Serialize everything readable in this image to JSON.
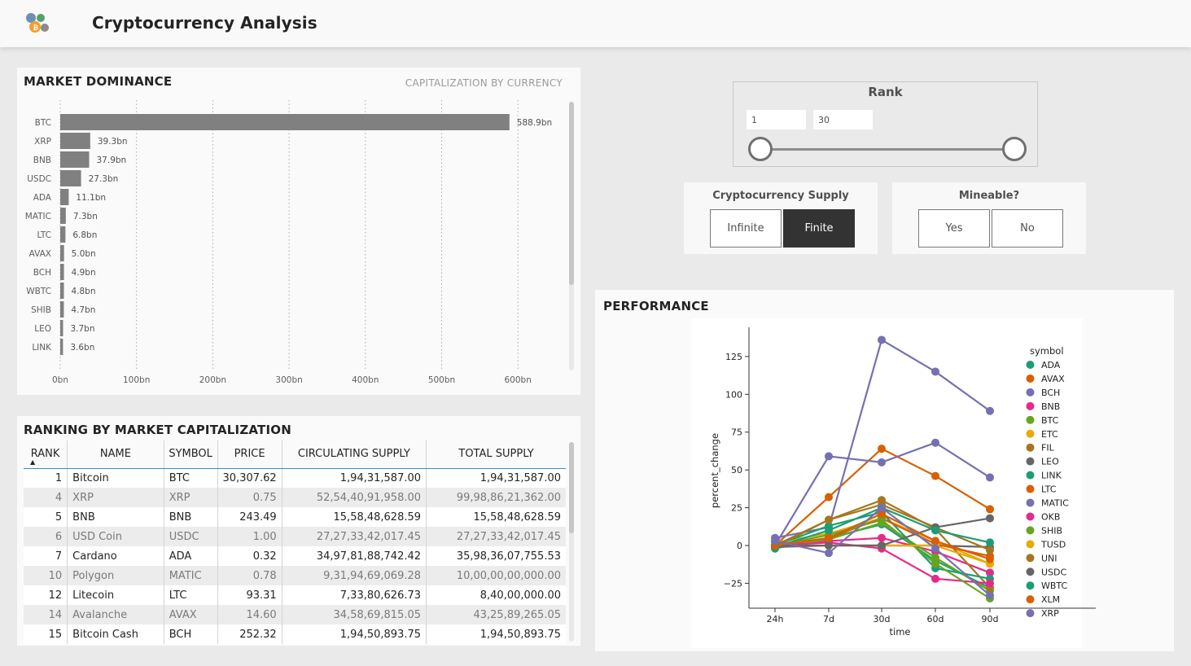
{
  "header": {
    "title": "Cryptocurrency Analysis",
    "logo_icon": "crypto-coins-logo"
  },
  "dominance": {
    "title": "MARKET DOMINANCE",
    "subtitle": "CAPITALIZATION BY CURRENCY"
  },
  "ranking": {
    "title": "RANKING BY MARKET CAPITALIZATION",
    "columns": [
      "RANK",
      "NAME",
      "SYMBOL",
      "PRICE",
      "CIRCULATING SUPPLY",
      "TOTAL SUPPLY"
    ],
    "rows": [
      [
        "1",
        "Bitcoin",
        "BTC",
        "30,307.62",
        "1,94,31,587.00",
        "1,94,31,587.00"
      ],
      [
        "4",
        "XRP",
        "XRP",
        "0.75",
        "52,54,40,91,958.00",
        "99,98,86,21,362.00"
      ],
      [
        "5",
        "BNB",
        "BNB",
        "243.49",
        "15,58,48,628.59",
        "15,58,48,628.59"
      ],
      [
        "6",
        "USD Coin",
        "USDC",
        "1.00",
        "27,27,33,42,017.45",
        "27,27,33,42,017.45"
      ],
      [
        "7",
        "Cardano",
        "ADA",
        "0.32",
        "34,97,81,88,742.42",
        "35,98,36,07,755.53"
      ],
      [
        "10",
        "Polygon",
        "MATIC",
        "0.78",
        "9,31,94,69,069.28",
        "10,00,00,00,000.00"
      ],
      [
        "12",
        "Litecoin",
        "LTC",
        "93.31",
        "7,33,80,626.73",
        "8,40,00,000.00"
      ],
      [
        "14",
        "Avalanche",
        "AVAX",
        "14.60",
        "34,58,69,815.05",
        "43,25,89,265.05"
      ],
      [
        "15",
        "Bitcoin Cash",
        "BCH",
        "252.32",
        "1,94,50,893.75",
        "1,94,50,893.75"
      ]
    ]
  },
  "rank_slicer": {
    "title": "Rank",
    "min": "1",
    "max": "30"
  },
  "supply_slicer": {
    "title": "Cryptocurrency Supply",
    "options": [
      "Infinite",
      "Finite"
    ],
    "selected": "Finite"
  },
  "mineable_slicer": {
    "title": "Mineable?",
    "options": [
      "Yes",
      "No"
    ]
  },
  "performance": {
    "title": "PERFORMANCE"
  },
  "colors": {
    "bar": "#808080",
    "selected_button": "#333333",
    "table_header_rule": "#3a8ec1"
  },
  "chart_data": [
    {
      "type": "bar",
      "orientation": "horizontal",
      "categories": [
        "BTC",
        "XRP",
        "BNB",
        "USDC",
        "ADA",
        "MATIC",
        "LTC",
        "AVAX",
        "BCH",
        "WBTC",
        "SHIB",
        "LEO",
        "LINK"
      ],
      "values": [
        588.9,
        39.3,
        37.9,
        27.3,
        11.1,
        7.3,
        6.8,
        5.0,
        4.9,
        4.8,
        4.7,
        3.7,
        3.6
      ],
      "data_labels": [
        "588.9bn",
        "39.3bn",
        "37.9bn",
        "27.3bn",
        "11.1bn",
        "7.3bn",
        "6.8bn",
        "5.0bn",
        "4.9bn",
        "4.8bn",
        "4.7bn",
        "3.7bn",
        "3.6bn"
      ],
      "xticks": [
        "0bn",
        "100bn",
        "200bn",
        "300bn",
        "400bn",
        "500bn",
        "600bn"
      ],
      "xlim": [
        0,
        600
      ],
      "grid": "vertical dotted"
    },
    {
      "type": "line",
      "x": [
        "24h",
        "7d",
        "30d",
        "60d",
        "90d"
      ],
      "xlabel": "time",
      "ylabel": "percent_change",
      "yticks": [
        -25,
        0,
        25,
        50,
        75,
        100,
        125
      ],
      "ylim": [
        -40,
        143
      ],
      "legend_title": "symbol",
      "legend": "right",
      "series": [
        {
          "name": "ADA",
          "color": "#1b9e77",
          "values": [
            -2,
            5,
            14,
            -10,
            -28
          ]
        },
        {
          "name": "AVAX",
          "color": "#d95f02",
          "values": [
            0,
            32,
            64,
            46,
            24
          ]
        },
        {
          "name": "BCH",
          "color": "#7570b3",
          "values": [
            5,
            12,
            136,
            115,
            89
          ]
        },
        {
          "name": "BNB",
          "color": "#e7298a",
          "values": [
            -1,
            3,
            5,
            -4,
            -18
          ]
        },
        {
          "name": "BTC",
          "color": "#66a61e",
          "values": [
            -1,
            4,
            15,
            -8,
            -30
          ]
        },
        {
          "name": "ETC",
          "color": "#e6ab02",
          "values": [
            2,
            8,
            18,
            3,
            -12
          ]
        },
        {
          "name": "FIL",
          "color": "#a6761d",
          "values": [
            0,
            17,
            30,
            11,
            -28
          ]
        },
        {
          "name": "LEO",
          "color": "#666666",
          "values": [
            -1,
            0,
            0,
            0,
            -1
          ]
        },
        {
          "name": "LINK",
          "color": "#1b9e77",
          "values": [
            0,
            13,
            22,
            -15,
            -22
          ]
        },
        {
          "name": "LTC",
          "color": "#d95f02",
          "values": [
            0,
            5,
            18,
            1,
            -7
          ]
        },
        {
          "name": "MATIC",
          "color": "#7570b3",
          "values": [
            0,
            59,
            55,
            68,
            45
          ]
        },
        {
          "name": "OKB",
          "color": "#e7298a",
          "values": [
            0,
            2,
            -2,
            -22,
            -25
          ]
        },
        {
          "name": "SHIB",
          "color": "#66a61e",
          "values": [
            0,
            7,
            17,
            -12,
            -35
          ]
        },
        {
          "name": "TUSD",
          "color": "#e6ab02",
          "values": [
            0,
            0,
            0,
            0,
            -12
          ]
        },
        {
          "name": "UNI",
          "color": "#a6761d",
          "values": [
            -1,
            17,
            27,
            12,
            -3
          ]
        },
        {
          "name": "USDC",
          "color": "#666666",
          "values": [
            0,
            0,
            0,
            12,
            18
          ]
        },
        {
          "name": "WBTC",
          "color": "#1b9e77",
          "values": [
            -1,
            10,
            25,
            10,
            2
          ]
        },
        {
          "name": "XLM",
          "color": "#d95f02",
          "values": [
            0,
            5,
            21,
            3,
            -9
          ]
        },
        {
          "name": "XRP",
          "color": "#7570b3",
          "values": [
            3,
            -5,
            25,
            -2,
            -33
          ]
        }
      ]
    }
  ]
}
